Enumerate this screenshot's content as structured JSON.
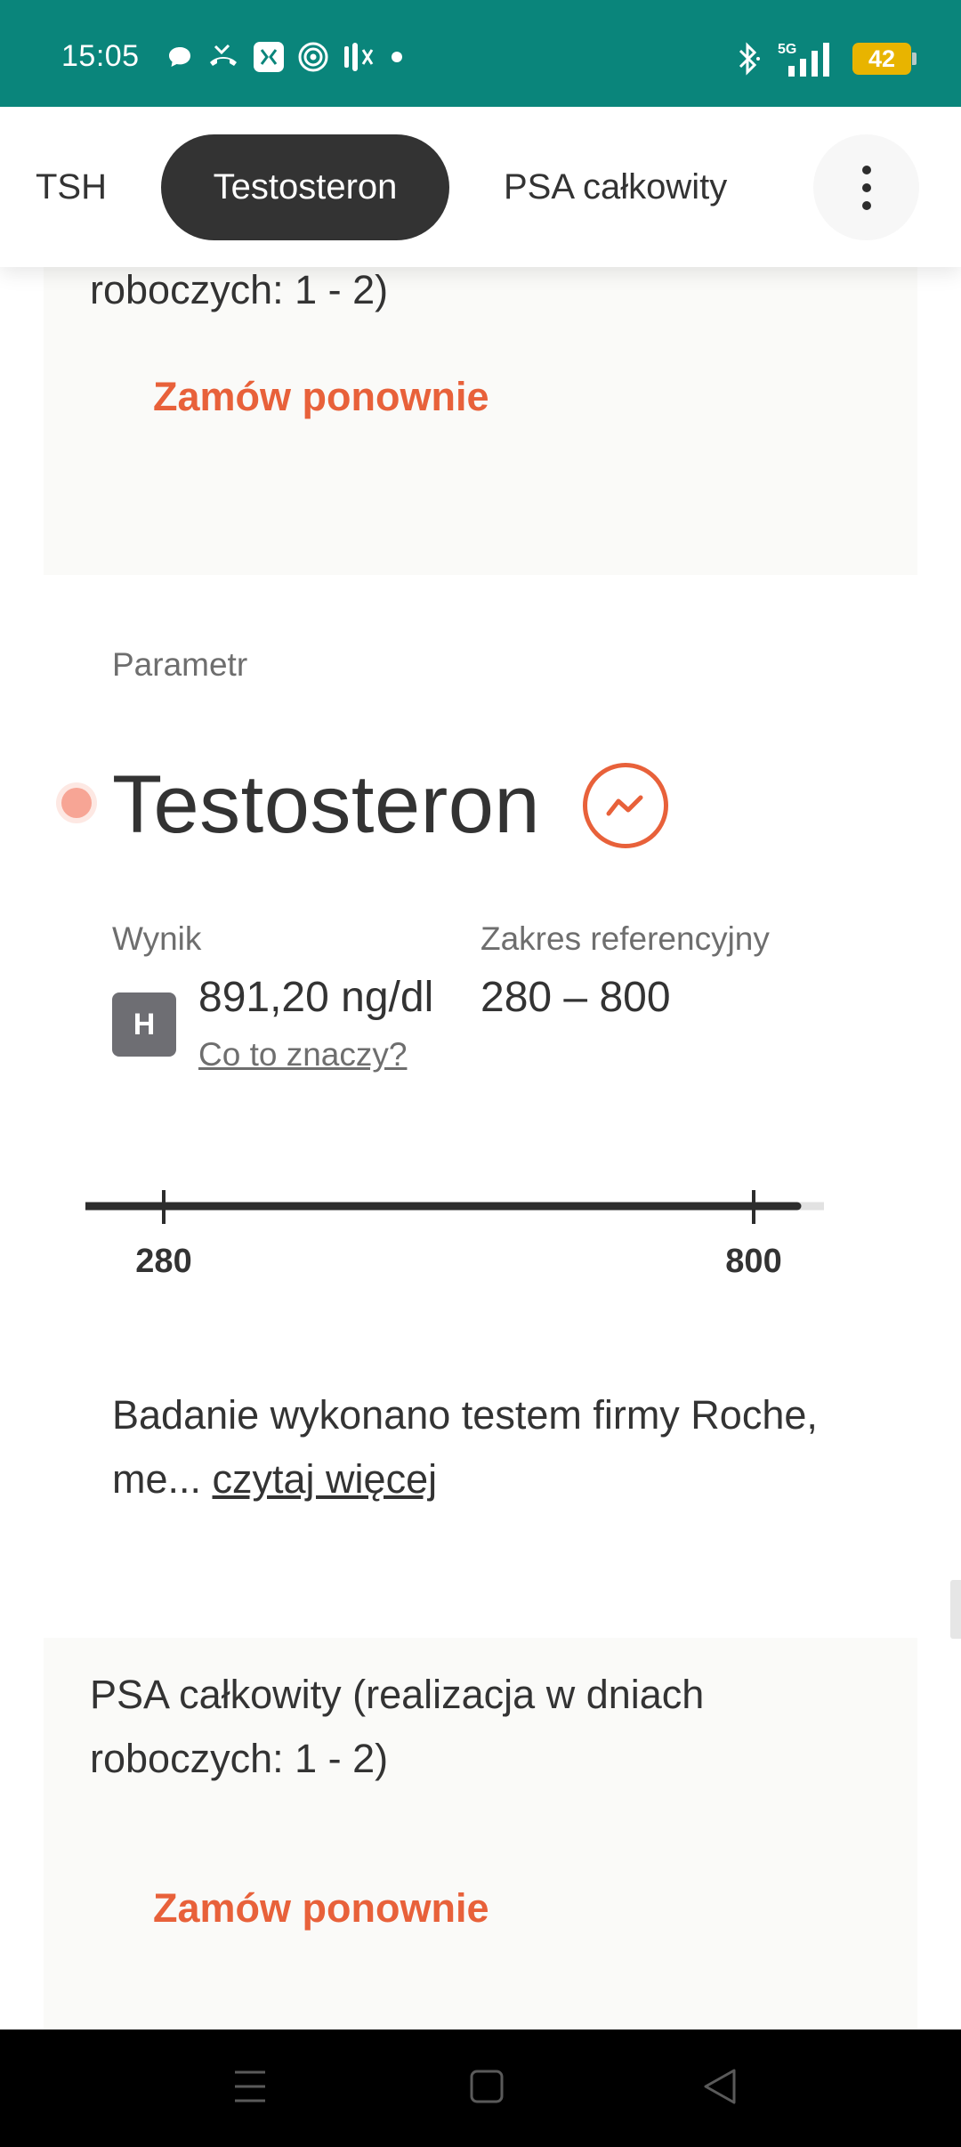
{
  "status_bar": {
    "time": "15:05",
    "network": "5G",
    "battery": "42",
    "notification_icons": [
      "chat-bubble-icon",
      "missed-call-icon",
      "app-icon",
      "target-icon",
      "sound-icon",
      "dot-icon"
    ],
    "colors": {
      "background": "#0a857b",
      "battery": "#e8b400"
    }
  },
  "tabs": {
    "items": [
      {
        "label": "TSH",
        "selected": false
      },
      {
        "label": "Testosteron",
        "selected": true
      },
      {
        "label": "PSA całkowity",
        "selected": false
      }
    ],
    "more_icon": "more-vertical-icon"
  },
  "order_card_top": {
    "title_tail": "roboczych: 1 - 2)",
    "reorder_label": "Zamów ponownie"
  },
  "parameter": {
    "section_label": "Parametr",
    "name": "Testosteron",
    "trend_icon": "trend-chart-icon",
    "result_label": "Wynik",
    "flag": "H",
    "result_value": "891,20 ng/dl",
    "meaning_link": "Co to znaczy?",
    "reference_label": "Zakres referencyjny",
    "reference_range": "280 – 800",
    "range_min_label": "280",
    "range_max_label": "800",
    "range_min": 280,
    "range_max": 800,
    "result_numeric": 891.2,
    "method_text": "Badanie wykonano testem firmy Roche, me... ",
    "method_link": "czytaj więcej"
  },
  "order_card_bottom": {
    "title": "PSA całkowity (realizacja w dniach roboczych: 1 - 2)",
    "reorder_label": "Zamów ponownie"
  },
  "colors": {
    "accent": "#e8613a",
    "text": "#333333",
    "muted": "#6e6e6e",
    "card_bg": "#fafaf8",
    "tab_selected_bg": "#333333"
  },
  "nav_bar": {
    "icons": [
      "menu-icon",
      "home-icon",
      "back-icon"
    ]
  }
}
